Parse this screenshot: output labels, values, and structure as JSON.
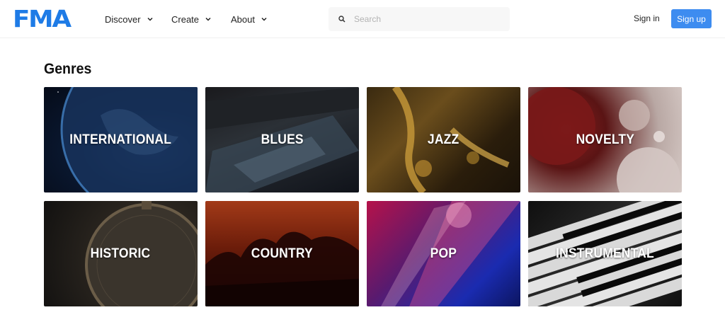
{
  "header": {
    "logo": "FMA",
    "nav": [
      {
        "label": "Discover"
      },
      {
        "label": "Create"
      },
      {
        "label": "About"
      }
    ],
    "search": {
      "placeholder": "Search",
      "value": ""
    },
    "sign_in": "Sign in",
    "sign_up": "Sign up"
  },
  "main": {
    "title": "Genres",
    "genres": [
      {
        "label": "INTERNATIONAL",
        "image": "earth-from-space"
      },
      {
        "label": "BLUES",
        "image": "sheet-music-piano"
      },
      {
        "label": "JAZZ",
        "image": "saxophone"
      },
      {
        "label": "NOVELTY",
        "image": "abstract-bubbles"
      },
      {
        "label": "HISTORIC",
        "image": "pocket-watch"
      },
      {
        "label": "COUNTRY",
        "image": "horse-riders-sunset"
      },
      {
        "label": "POP",
        "image": "concert-lights"
      },
      {
        "label": "INSTRUMENTAL",
        "image": "piano-keys"
      }
    ]
  },
  "colors": {
    "brand": "#1e7be6",
    "signup_bg": "#3d8cf0",
    "text": "#1a1a1a"
  }
}
